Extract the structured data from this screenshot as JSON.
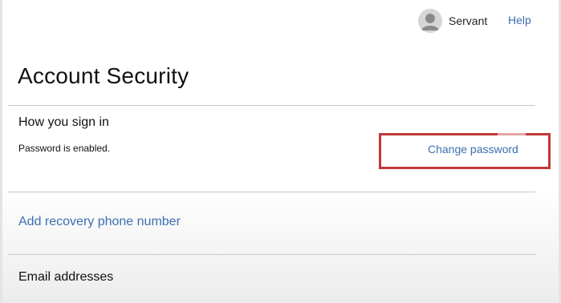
{
  "header": {
    "username": "Servant",
    "help_label": "Help",
    "avatar_icon": "user-avatar-icon"
  },
  "main": {
    "title": "Account Security",
    "sign_in": {
      "heading": "How you sign in",
      "status": "Password is enabled.",
      "change_password_label": "Change password"
    },
    "recovery": {
      "add_phone_label": "Add recovery phone number"
    },
    "email": {
      "heading": "Email addresses"
    }
  },
  "colors": {
    "link": "#3a6fb0",
    "highlight": "#c0383a",
    "divider": "#c8c8c8"
  }
}
